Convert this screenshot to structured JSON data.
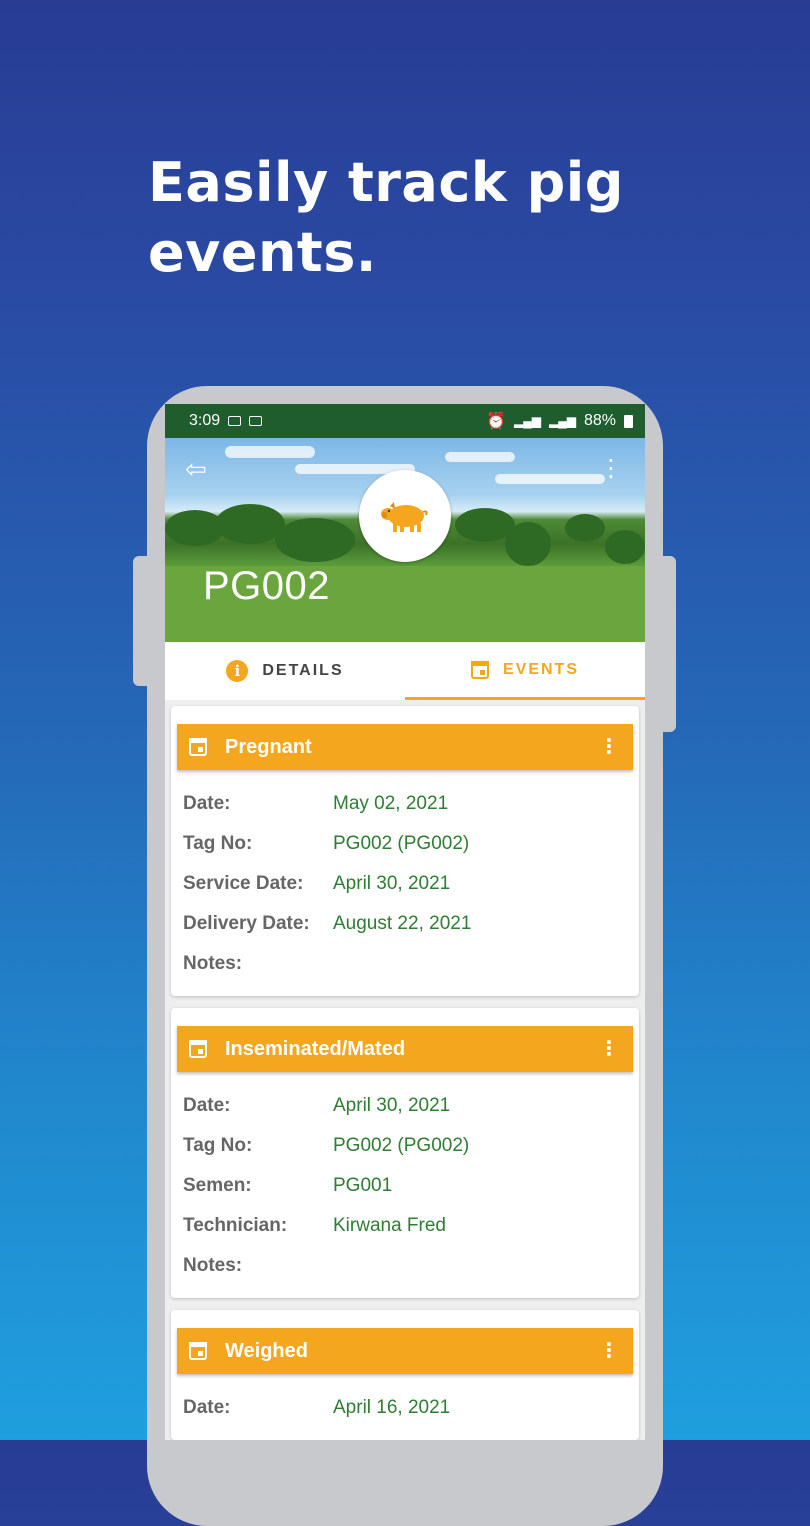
{
  "headline": "Easily track pig events.",
  "status_bar": {
    "time": "3:09",
    "battery": "88%"
  },
  "pig": {
    "id": "PG002"
  },
  "tabs": {
    "details": "DETAILS",
    "events": "EVENTS"
  },
  "colors": {
    "accent": "#f4a61e",
    "value_green": "#2e7d32",
    "status_bar": "#1f5c2e"
  },
  "events": [
    {
      "title": "Pregnant",
      "fields": [
        {
          "label": "Date:",
          "value": "May 02, 2021"
        },
        {
          "label": "Tag No:",
          "value": "PG002 (PG002)"
        },
        {
          "label": "Service Date:",
          "value": "April 30, 2021"
        },
        {
          "label": "Delivery Date:",
          "value": "August 22, 2021"
        },
        {
          "label": "Notes:",
          "value": ""
        }
      ]
    },
    {
      "title": "Inseminated/Mated",
      "fields": [
        {
          "label": "Date:",
          "value": "April 30, 2021"
        },
        {
          "label": "Tag No:",
          "value": "PG002 (PG002)"
        },
        {
          "label": "Semen:",
          "value": "PG001"
        },
        {
          "label": "Technician:",
          "value": "Kirwana Fred"
        },
        {
          "label": "Notes:",
          "value": ""
        }
      ]
    },
    {
      "title": "Weighed",
      "fields": [
        {
          "label": "Date:",
          "value": "April 16, 2021"
        }
      ]
    }
  ]
}
